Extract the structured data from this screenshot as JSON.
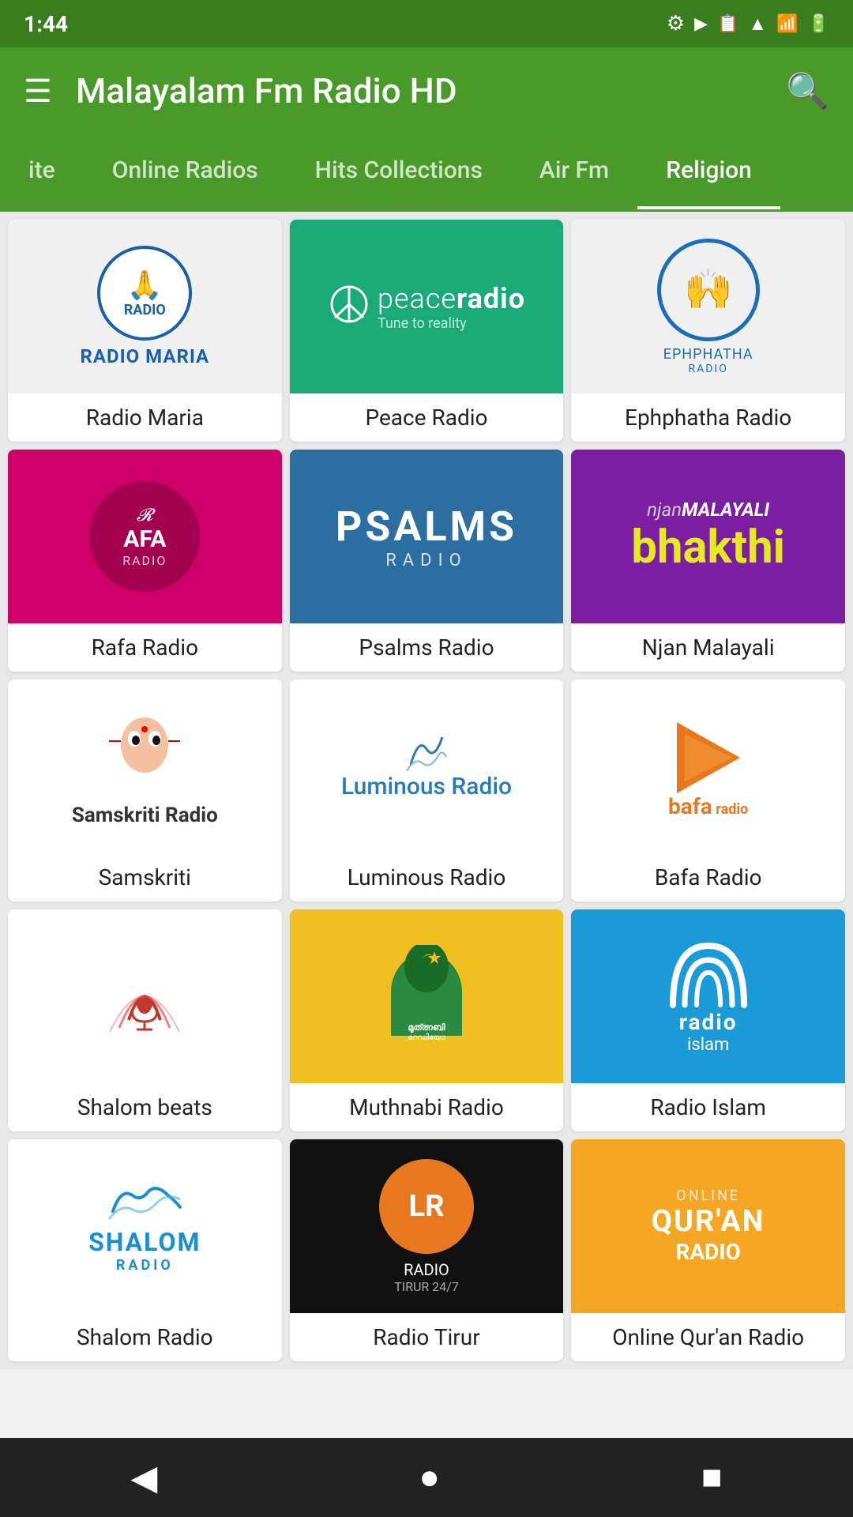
{
  "app": {
    "title": "Malayalam Fm Radio HD"
  },
  "status_bar": {
    "time": "1:44",
    "settings_icon": "settings-icon",
    "play_icon": "play-icon",
    "storage_icon": "storage-icon",
    "wifi_icon": "wifi-icon",
    "signal_icon": "signal-icon",
    "battery_icon": "battery-icon"
  },
  "tabs": [
    {
      "label": "ite",
      "id": "favourite",
      "active": false
    },
    {
      "label": "Online Radios",
      "id": "online-radios",
      "active": false
    },
    {
      "label": "Hits Collections",
      "id": "hits-collections",
      "active": false
    },
    {
      "label": "Air Fm",
      "id": "air-fm",
      "active": false
    },
    {
      "label": "Religion",
      "id": "religion",
      "active": true
    }
  ],
  "grid_items": [
    {
      "id": "radio-maria",
      "label": "Radio Maria",
      "card_class": "card-radio-maria"
    },
    {
      "id": "peace-radio",
      "label": "Peace Radio",
      "card_class": "card-peace-radio"
    },
    {
      "id": "ephphatha-radio",
      "label": "Ephphatha Radio",
      "card_class": "card-ephphatha"
    },
    {
      "id": "rafa-radio",
      "label": "Rafa Radio",
      "card_class": "card-rafa"
    },
    {
      "id": "psalms-radio",
      "label": "Psalms Radio",
      "card_class": "card-psalms"
    },
    {
      "id": "njan-malayali",
      "label": "Njan Malayali",
      "card_class": "card-njan"
    },
    {
      "id": "samskriti",
      "label": "Samskriti",
      "card_class": "card-samskriti"
    },
    {
      "id": "luminous-radio",
      "label": "Luminous Radio",
      "card_class": "card-luminous"
    },
    {
      "id": "bafa-radio",
      "label": "Bafa Radio",
      "card_class": "card-bafa"
    },
    {
      "id": "shalom-beats",
      "label": "Shalom beats",
      "card_class": "card-shalom-beats"
    },
    {
      "id": "muthnabi-radio",
      "label": "Muthnabi Radio",
      "card_class": "card-muthnabi"
    },
    {
      "id": "radio-islam",
      "label": "Radio Islam",
      "card_class": "card-radio-islam"
    },
    {
      "id": "shalom-radio",
      "label": "Shalom Radio",
      "card_class": "card-shalom-radio"
    },
    {
      "id": "tirur-radio",
      "label": "Radio Tirur",
      "card_class": "card-tirur"
    },
    {
      "id": "quran-radio",
      "label": "Online Qur'an Radio",
      "card_class": "card-quran"
    }
  ],
  "bottom_nav": {
    "back_label": "◀",
    "home_label": "●",
    "recent_label": "■"
  },
  "icons": {
    "menu": "☰",
    "search": "🔍",
    "settings": "⚙",
    "play": "▶",
    "storage": "📋"
  }
}
